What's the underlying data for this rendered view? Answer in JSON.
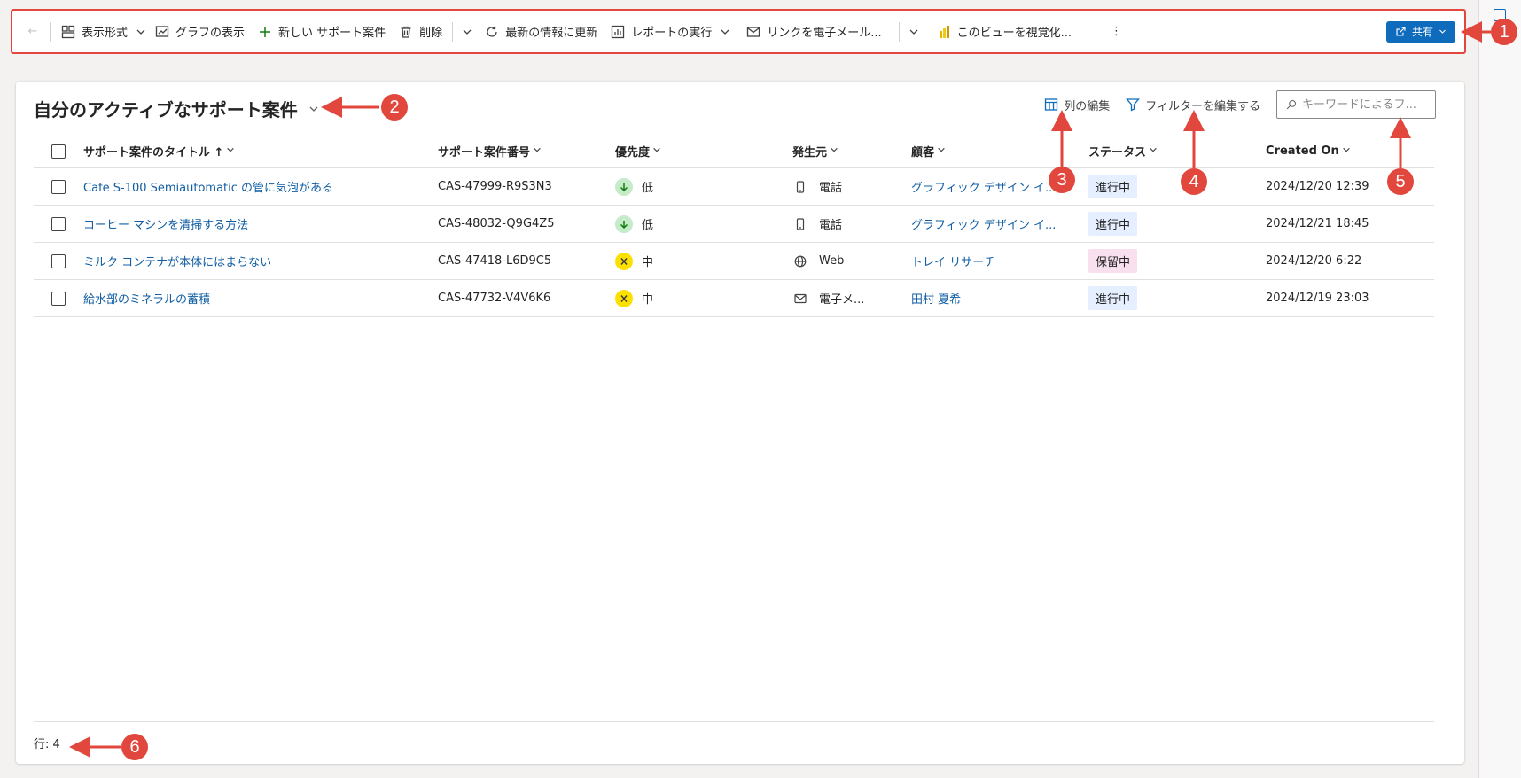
{
  "command_bar": {
    "back_label": "←",
    "view_as_label": "表示形式",
    "show_chart_label": "グラフの表示",
    "new_case_label": "新しい サポート案件",
    "delete_label": "削除",
    "refresh_label": "最新の情報に更新",
    "run_report_label": "レポートの実行",
    "email_link_label": "リンクを電子メール...",
    "visualize_label": "このビューを視覚化...",
    "more_label": "⋮",
    "share_label": "共有"
  },
  "view": {
    "title": "自分のアクティブなサポート案件",
    "edit_columns_label": "列の編集",
    "edit_filters_label": "フィルターを編集する",
    "search_placeholder": "キーワードによるフ..."
  },
  "table": {
    "headers": {
      "title": "サポート案件のタイトル ↑",
      "case_number": "サポート案件番号",
      "priority": "優先度",
      "origin": "発生元",
      "customer": "顧客",
      "status": "ステータス",
      "created_on": "Created On"
    },
    "rows": [
      {
        "title": "Cafe S-100 Semiautomatic の管に気泡がある",
        "case_number": "CAS-47999-R9S3N3",
        "priority": "低",
        "priority_icon": "arrow-down-icon",
        "origin": "電話",
        "origin_icon": "phone-icon",
        "customer": "グラフィック デザイン イ...",
        "status": "進行中",
        "created_on": "2024/12/20 12:39"
      },
      {
        "title": "コーヒー マシンを清掃する方法",
        "case_number": "CAS-48032-Q9G4Z5",
        "priority": "低",
        "priority_icon": "arrow-down-icon",
        "origin": "電話",
        "origin_icon": "phone-icon",
        "customer": "グラフィック デザイン イ...",
        "status": "進行中",
        "created_on": "2024/12/21 18:45"
      },
      {
        "title": "ミルク コンテナが本体にはまらない",
        "case_number": "CAS-47418-L6D9C5",
        "priority": "中",
        "priority_icon": "medium-icon",
        "origin": "Web",
        "origin_icon": "globe-icon",
        "customer": "トレイ リサーチ",
        "status": "保留中",
        "created_on": "2024/12/20 6:22"
      },
      {
        "title": "給水部のミネラルの蓄積",
        "case_number": "CAS-47732-V4V6K6",
        "priority": "中",
        "priority_icon": "medium-icon",
        "origin": "電子メ...",
        "origin_icon": "mail-icon",
        "customer": "田村 夏希",
        "status": "進行中",
        "created_on": "2024/12/19 23:03"
      }
    ]
  },
  "footer": {
    "row_count": "行: 4"
  },
  "annotations": [
    "1",
    "2",
    "3",
    "4",
    "5",
    "6"
  ],
  "colors": {
    "accent": "#0f6cbd",
    "annotation": "#e1473d",
    "link": "#115ea3"
  }
}
